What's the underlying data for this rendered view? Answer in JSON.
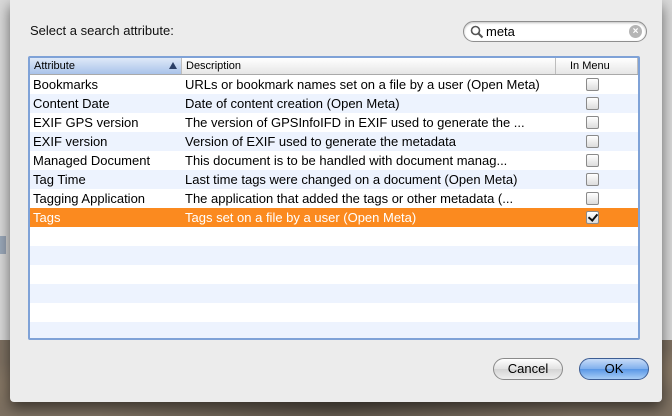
{
  "dialog": {
    "prompt": "Select a search attribute:",
    "search_value": "meta",
    "clear_glyph": "×"
  },
  "table": {
    "columns": [
      "Attribute",
      "Description",
      "In Menu"
    ],
    "rows": [
      {
        "attribute": "Bookmarks",
        "description": "URLs or bookmark names set on a file by a user (Open Meta)",
        "in_menu": false
      },
      {
        "attribute": "Content Date",
        "description": "Date of content creation (Open Meta)",
        "in_menu": false
      },
      {
        "attribute": "EXIF GPS version",
        "description": "The version of GPSInfoIFD in EXIF used to generate the ...",
        "in_menu": false
      },
      {
        "attribute": "EXIF version",
        "description": "Version of EXIF used to generate the metadata",
        "in_menu": false
      },
      {
        "attribute": "Managed Document",
        "description": "This document is to be handled with document manag...",
        "in_menu": false
      },
      {
        "attribute": "Tag Time",
        "description": "Last time tags were changed on a document (Open Meta)",
        "in_menu": false
      },
      {
        "attribute": "Tagging Application",
        "description": "The application that added the tags or other metadata (...",
        "in_menu": false
      },
      {
        "attribute": "Tags",
        "description": "Tags set on a file by a user (Open Meta)",
        "in_menu": true
      }
    ],
    "selected_index": 7
  },
  "buttons": {
    "cancel": "Cancel",
    "ok": "OK"
  },
  "colors": {
    "selection": "#fb8a1f",
    "alt_row": "#edf3fe",
    "focus_ring": "#7fa2d7",
    "default_button": "#5a97e6"
  },
  "icons": {
    "search": "magnifier-icon",
    "clear": "clear-search-icon",
    "sort": "sort-ascending-icon",
    "checkbox": "checkbox-icon"
  }
}
